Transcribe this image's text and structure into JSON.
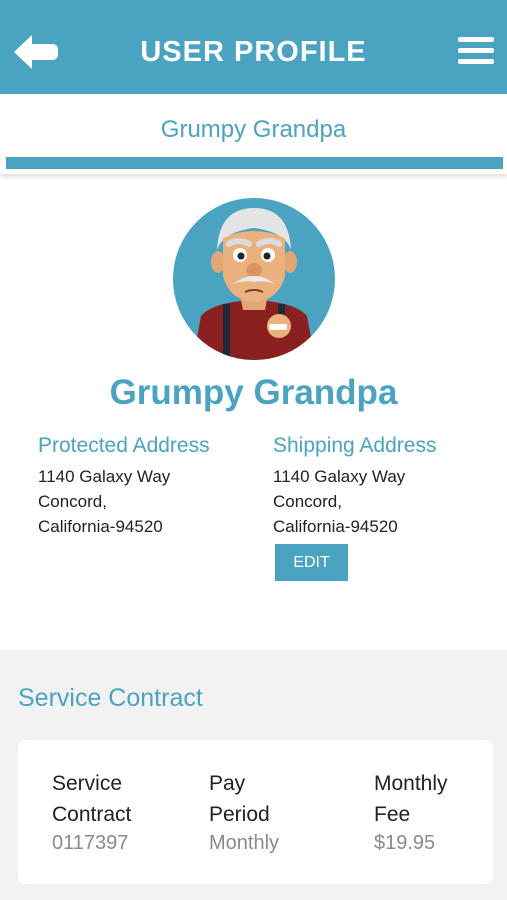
{
  "header": {
    "title": "USER PROFILE",
    "back_icon": "back-arrow-icon",
    "menu_icon": "hamburger-menu-icon",
    "color": "#4aa3c0"
  },
  "tab": {
    "label": "Grumpy Grandpa"
  },
  "profile": {
    "name": "Grumpy Grandpa",
    "avatar_icon": "grandpa-avatar"
  },
  "protected_address": {
    "title": "Protected Address",
    "line1": "1140 Galaxy Way",
    "line2": "Concord,",
    "line3": "California-94520"
  },
  "shipping_address": {
    "title": "Shipping Address",
    "line1": "1140 Galaxy Way",
    "line2": "Concord,",
    "line3": "California-94520",
    "edit_label": "EDIT"
  },
  "service_contract": {
    "section_title": "Service Contract",
    "contract_label_1": "Service",
    "contract_label_2": "Contract",
    "contract_value": "0117397",
    "pay_label_1": "Pay",
    "pay_label_2": "Period",
    "pay_value": "Monthly",
    "fee_label_1": "Monthly",
    "fee_label_2": "Fee",
    "fee_value": "$19.95"
  }
}
